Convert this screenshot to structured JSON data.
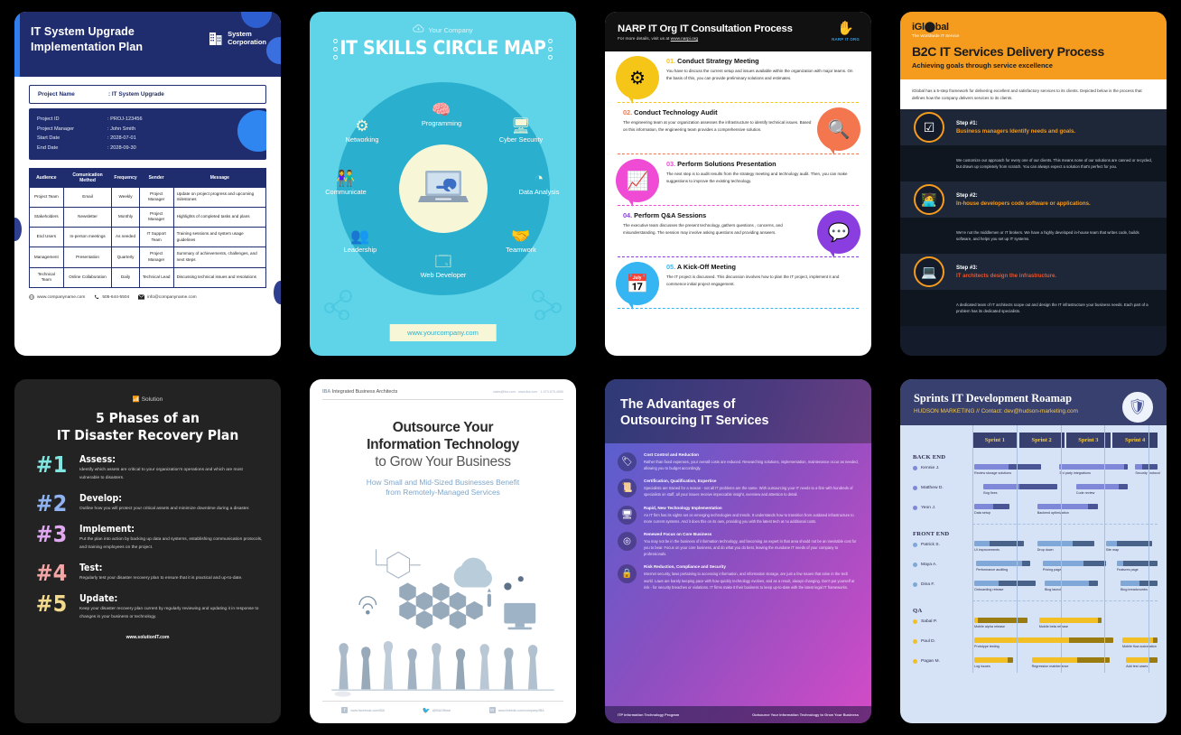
{
  "page": {
    "background": "#000000",
    "title": "IT Infographic Template Gallery"
  },
  "card1": {
    "header": {
      "title_line1": "IT System Upgrade",
      "title_line2": "Implementation Plan",
      "company_line1": "System",
      "company_line2": "Corporation",
      "icon": "building-icon",
      "bg": "#1f2d6e",
      "accent": "#2f7ff0"
    },
    "project_name": {
      "label": "Project Name",
      "value": ": IT System Upgrade"
    },
    "details": [
      {
        "label": "Project ID",
        "value": ": PROJ-123456"
      },
      {
        "label": "Project Manager",
        "value": ": John Smith"
      },
      {
        "label": "Start Date",
        "value": ": 2028-07-01"
      },
      {
        "label": "End Date",
        "value": ": 2028-09-30"
      }
    ],
    "table": {
      "columns": [
        "Audience",
        "Comunication Method",
        "Frequency",
        "Sender",
        "Message"
      ],
      "rows": [
        [
          "Project Team",
          "Email",
          "Weekly",
          "Project Manager",
          "Update on project progress and upcoming milestones"
        ],
        [
          "Stakeholders",
          "Newsletter",
          "Monthly",
          "Project Manager",
          "Highlights of completed tasks and plans"
        ],
        [
          "End Users",
          "In-person meetings",
          "As needed",
          "IT Support Team",
          "Training sessions and system usage guidelines"
        ],
        [
          "Management",
          "Presentation",
          "Quarterly",
          "Project Manager",
          "Summary of achievements, challenges, and next steps"
        ],
        [
          "Technical Team",
          "Online Collaboration",
          "Daily",
          "Technical Lead",
          "Discussing technical issues and resolutions"
        ]
      ]
    },
    "footer": {
      "website": "www.companyname.com",
      "website_icon": "globe-icon",
      "phone": "505-644-5504",
      "phone_icon": "phone-icon",
      "email": "info@companyname.com",
      "email_icon": "envelope-icon"
    }
  },
  "card2": {
    "brand": "Your Company",
    "brand_icon": "cloud-download-icon",
    "title": "IT SKILLS CIRCLE MAP",
    "center_icon": "laptop-wrench-icon",
    "url": "www.yourcompany.com",
    "colors": {
      "bg": "#5fd3e8",
      "ring": "#2ab0ce",
      "cream": "#f7f7d8"
    },
    "skills": [
      {
        "label": "Programming",
        "icon": "head-code-icon"
      },
      {
        "label": "Cyber Security",
        "icon": "monitor-spy-icon"
      },
      {
        "label": "Data Analysis",
        "icon": "pie-chart-icon"
      },
      {
        "label": "Teamwork",
        "icon": "handshake-icon"
      },
      {
        "label": "Web Developer",
        "icon": "browser-window-icon"
      },
      {
        "label": "Leadership",
        "icon": "people-group-icon"
      },
      {
        "label": "Communicate",
        "icon": "two-people-speech-icon"
      },
      {
        "label": "Networking",
        "icon": "network-nodes-icon"
      }
    ]
  },
  "card3": {
    "header": {
      "title": "NARP IT Org IT Consultation Process",
      "subtitle_prefix": "For more details, visit us at ",
      "subtitle_link": "www.narpi.org",
      "logo_icon": "hand-icon",
      "logo_text": "NARP IT ORG"
    },
    "steps": [
      {
        "num": "01.",
        "title": "Conduct Strategy Meeting",
        "body": "You have to discuss the current setup and issues available within the organization with major teams. On the basis of this, you can provide preliminary solutions and estimates.",
        "color": "#f5c518",
        "icon": "head-gear-icon",
        "side": "left"
      },
      {
        "num": "02.",
        "title": "Conduct Technology Audit",
        "body": "The engineering team at your organization assesses the infrastructure to identify technical issues. Based on this information, the engineering team provides a comprehensive solution.",
        "color": "#f3764f",
        "icon": "document-search-icon",
        "side": "right"
      },
      {
        "num": "03.",
        "title": "Perform Solutions Presentation",
        "body": "The next step is to audit results from the strategy meeting and technology audit. Then, you can make suggestions to improve the existing technology.",
        "color": "#ef4bd4",
        "icon": "presentation-chart-icon",
        "side": "left"
      },
      {
        "num": "04.",
        "title": "Perform Q&A Sessions",
        "body": "The executive team discusses the present technology, gathers questions , concerns, and misunderstanding. The session may involve asking questions and providing answers.",
        "color": "#8b3ee0",
        "icon": "qa-bubbles-icon",
        "side": "right"
      },
      {
        "num": "05.",
        "title": "A Kick-Off Meeting",
        "body": "The IT project is discussed. This discussion involves how to plan the IT project, implement it and commence initial project engagement.",
        "color": "#35b6f2",
        "icon": "calendar-check-icon",
        "side": "left"
      }
    ]
  },
  "card4": {
    "brand": "iGl⬤bal",
    "tagline": "The Worldwide IT Service",
    "title": "B2C IT Services Delivery Process",
    "subtitle": "Achieving goals through service excellence",
    "intro": "iGlobal has a 5-step framework for delivering excellent and satisfactory services to its clients. Depicted below is the process that defines how the company delivers services to its clients.",
    "accent": "#f59b1e",
    "steps": [
      {
        "label": "Step #1:",
        "headline": "Business managers Identify needs and goals.",
        "icon": "checklist-icon",
        "body": "We customize our approach for every one of our clients. This means none of our solutions are canned or recycled, but drawn up completely from scratch. You can always expect a solution that's perfect for you.",
        "color": "#f59b1e"
      },
      {
        "label": "Step #2:",
        "headline": "In-house developers code software or applications.",
        "icon": "developer-desk-icon",
        "body": "We're not the middlemen or IT brokers. We have a highly developed in-house team that writes code, builds software, and helps you set up IT systems.",
        "color": "#f59b1e"
      },
      {
        "label": "Step #3:",
        "headline": "IT architects design the infrastructure.",
        "icon": "laptop-icon",
        "body": "A dedicated team of IT architects scope out and design the IT infrastructure your business needs. Each part of a problem has its dedicated specialists.",
        "color": "#e8542a"
      }
    ]
  },
  "card5": {
    "eyebrow": "Solution",
    "eyebrow_icon": "wifi-icon",
    "title_line1": "5 Phases of an",
    "title_line2": "IT Disaster Recovery Plan",
    "website": "www.solutionIT.com",
    "phases": [
      {
        "num": "#1",
        "title": "Assess:",
        "body": "Identify which assets are critical to your organization's operations and which are most vulnerable to disasters.",
        "color": "#7fe6e0"
      },
      {
        "num": "#2",
        "title": "Develop:",
        "body": "Outline how you will protect your critical assets and minimize downtime during a disaster.",
        "color": "#8fb2f2"
      },
      {
        "num": "#3",
        "title": "Implement:",
        "body": "Put the plan into action by backing up data and systems, establishing communication protocols, and training employees on the project.",
        "color": "#e0a8f0"
      },
      {
        "num": "#4",
        "title": "Test:",
        "body": "Regularly test your disaster recovery plan to ensure that it is practical and up-to-date.",
        "color": "#f4a6a6"
      },
      {
        "num": "#5",
        "title": "Update:",
        "body": "Keep your disaster recovery plan current by regularly reviewing and updating it in response to changes in your business or technology.",
        "color": "#f2d98c"
      }
    ]
  },
  "card6": {
    "brand_abbr": "IBA",
    "brand_name": "Integrated Business Architects",
    "contact": "sales@iba.com · www.iba.com · 1-973-575-4950",
    "title_line1": "Outsource Your",
    "title_line2": "Information Technology",
    "title_line3": "to Grow Your Business",
    "sub_line1": "How Small and Mid-Sized Businesses Benefit",
    "sub_line2": "from Remotely-Managed Services",
    "social": [
      {
        "icon": "facebook-icon",
        "label": "www.facebook.com/IBA"
      },
      {
        "icon": "twitter-icon",
        "label": "@IBAOfficial"
      },
      {
        "icon": "linkedin-icon",
        "label": "www.linkedin.com/company/IBA"
      }
    ]
  },
  "card7": {
    "title_line1": "The Advantages of",
    "title_line2": "Outsourcing IT Services",
    "footer_left": "ITP Information Technology Program",
    "footer_right": "Outsource Your Information Technology to Grow Your Business",
    "items": [
      {
        "icon": "tag-icon",
        "title": "Cost Control and Reduction",
        "body": "Rather than fixed expenses, your overall costs are reduced. Researching solutions, implementation, maintenance occur as needed, allowing you to budget accordingly."
      },
      {
        "icon": "certificate-icon",
        "title": "Certification, Qualification, Expertise",
        "body": "Specialists are trained for a reason - not all IT problems are the same. With outsourcing your IT needs to a firm with hundreds of specialists on staff, all your issues receive impeccable insight, overview and attention to detail."
      },
      {
        "icon": "screen-refresh-icon",
        "title": "Rapid, New Technology Implementation",
        "body": "An IT firm has its sights set on emerging technologies and trends. It understands how to transition from outdated infrastructure to more current systems. And it does this on its own, providing you with the latest tech at no additional costs."
      },
      {
        "icon": "target-icon",
        "title": "Renewed Focus on Core Business",
        "body": "You may not be in the business of information technology, and becoming an expert in that area should not be an inevitable cost for you to bear. Focus on your core business, and do what you do best, leaving the mundane IT needs of your company to professionals."
      },
      {
        "icon": "lock-icon",
        "title": "Risk Reduction, Compliance and Security",
        "body": "Internet security, laws pertaining to accessing information, and information storage, are just a few issues that arise in the tech world. Laws are barely keeping pace with how quickly technology evolves, and as a result, always changing. Don't put yourself at risk - for security breaches or violations. IT firms make it their business to keep up-to-date with the latest legal IT frameworks."
      }
    ]
  },
  "card8": {
    "title": "Sprints IT Development Roamap",
    "subtitle": "HUDSON MARKETING // Contact: dev@hudson-marketing.com",
    "badge_icon": "shield-network-icon",
    "chart_data": {
      "type": "bar",
      "title": "Sprints IT Development Roamap",
      "categories": [
        "Sprint 1",
        "Sprint 2",
        "Sprint 3",
        "Sprint 4"
      ],
      "xlabel": "",
      "ylabel": "",
      "grid": true,
      "legend": "none",
      "groups": [
        {
          "name": "BACK END",
          "color": "#7f87d8",
          "fill": "#4a5596",
          "rows": [
            {
              "person": "Kennie J.",
              "tasks": [
                {
                  "label": "Review storage solutions",
                  "start": 1,
                  "end": 37,
                  "progress": 52
                },
                {
                  "label": "3rd party integrations",
                  "start": 47,
                  "end": 84,
                  "progress": 95
                },
                {
                  "label": "Security protocol",
                  "start": 88,
                  "end": 100,
                  "progress": 30
                }
              ]
            },
            {
              "person": "Matthew D.",
              "tasks": [
                {
                  "label": "Bug fixes",
                  "start": 6,
                  "end": 46,
                  "progress": 48
                },
                {
                  "label": "Code review",
                  "start": 56,
                  "end": 84,
                  "progress": 82
                }
              ]
            },
            {
              "person": "Yeon J.",
              "tasks": [
                {
                  "label": "Data setup",
                  "start": 1,
                  "end": 20,
                  "progress": 55
                },
                {
                  "label": "Backend optimization",
                  "start": 35,
                  "end": 68,
                  "progress": 83
                }
              ]
            }
          ]
        },
        {
          "name": "FRONT END",
          "color": "#7fa8d8",
          "fill": "#49628a",
          "rows": [
            {
              "person": "Patrick S.",
              "tasks": [
                {
                  "label": "UI improvements",
                  "start": 1,
                  "end": 28,
                  "progress": 30
                },
                {
                  "label": "Drop down",
                  "start": 35,
                  "end": 66,
                  "progress": 62
                },
                {
                  "label": "Site map",
                  "start": 72,
                  "end": 97,
                  "progress": 25
                }
              ]
            },
            {
              "person": "Maya A.",
              "tasks": [
                {
                  "label": "Performance auditing",
                  "start": 2,
                  "end": 31,
                  "progress": 85
                },
                {
                  "label": "Pricing page",
                  "start": 38,
                  "end": 72,
                  "progress": 64
                },
                {
                  "label": "Features page",
                  "start": 78,
                  "end": 100,
                  "progress": 15
                }
              ]
            },
            {
              "person": "Dina F.",
              "tasks": [
                {
                  "label": "Onboarding release",
                  "start": 1,
                  "end": 34,
                  "progress": 40
                },
                {
                  "label": "Blog launch",
                  "start": 39,
                  "end": 68,
                  "progress": 82
                },
                {
                  "label": "Blog breadcrumbs",
                  "start": 80,
                  "end": 100,
                  "progress": 52
                }
              ]
            }
          ]
        },
        {
          "name": "QA",
          "color": "#f2c025",
          "fill": "#9a7b0f",
          "rows": [
            {
              "person": "Sabal P.",
              "tasks": [
                {
                  "label": "Mobile alpha release",
                  "start": 1,
                  "end": 30,
                  "progress": 6
                },
                {
                  "label": "Mobile beta release",
                  "start": 36,
                  "end": 70,
                  "progress": 94
                }
              ]
            },
            {
              "person": "Paul D.",
              "tasks": [
                {
                  "label": "Prototype testing",
                  "start": 1,
                  "end": 76,
                  "progress": 68
                },
                {
                  "label": "Mobile flow automation",
                  "start": 81,
                  "end": 100,
                  "progress": 88
                }
              ]
            },
            {
              "person": "Pagan M.",
              "tasks": [
                {
                  "label": "Log issues",
                  "start": 1,
                  "end": 22,
                  "progress": 85
                },
                {
                  "label": "Regression maintenance",
                  "start": 32,
                  "end": 74,
                  "progress": 58
                },
                {
                  "label": "Add test cases",
                  "start": 83,
                  "end": 100,
                  "progress": 72
                }
              ]
            }
          ]
        }
      ]
    }
  }
}
